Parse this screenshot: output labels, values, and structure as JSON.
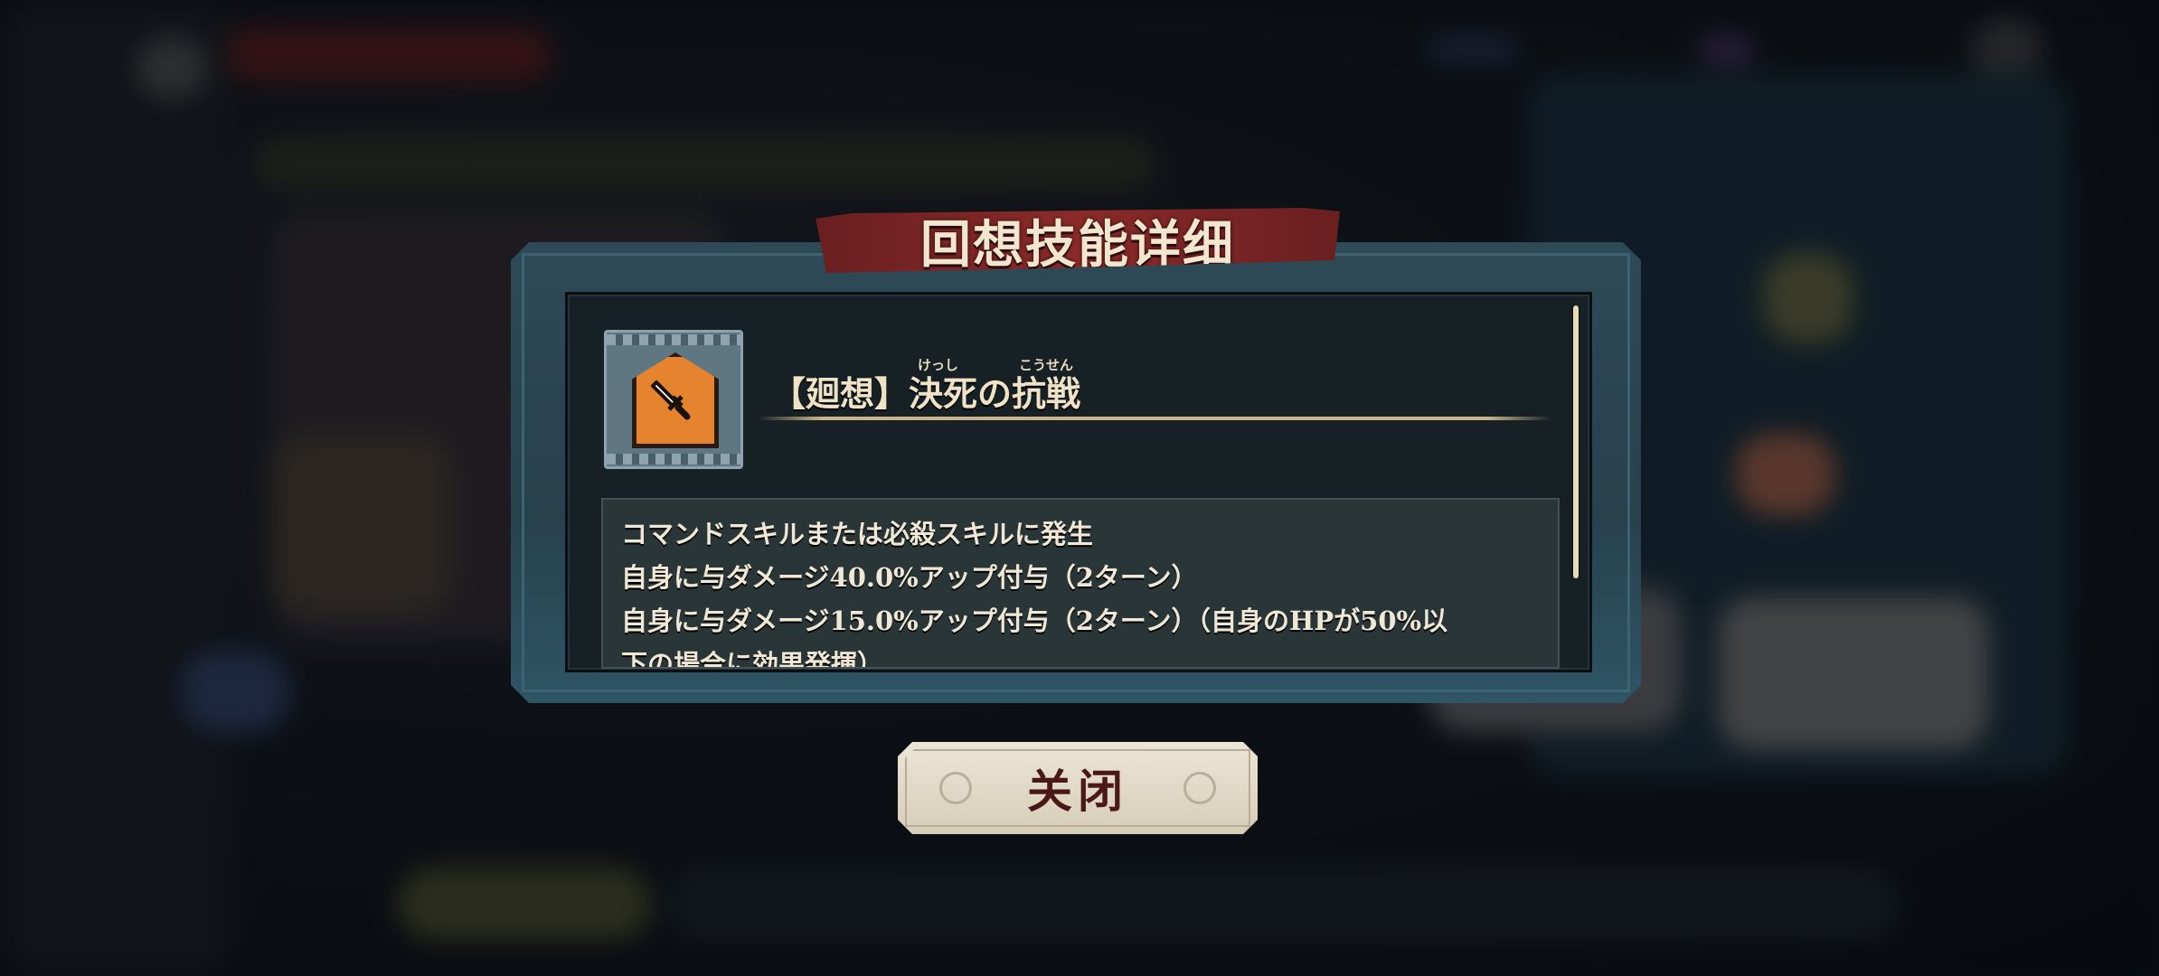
{
  "dialog": {
    "title": "回想技能详细",
    "skill": {
      "icon": "sword-icon",
      "name": "【廻想】決死の抗戦",
      "furigana": [
        "けっし",
        "こうせん"
      ]
    },
    "description_lines": [
      "コマンドスキルまたは必殺スキルに発生",
      "自身に与ダメージ40.0%アップ付与（2ターン）",
      "自身に与ダメージ15.0%アップ付与（2ターン）（自身のHPが50%以",
      "下の場合に効果発揮）"
    ],
    "close_label": "关闭"
  },
  "colors": {
    "banner": "#8a2b2a",
    "skill_icon": "#e6832f",
    "text": "#f0e8d6",
    "button_text": "#4a1816"
  }
}
